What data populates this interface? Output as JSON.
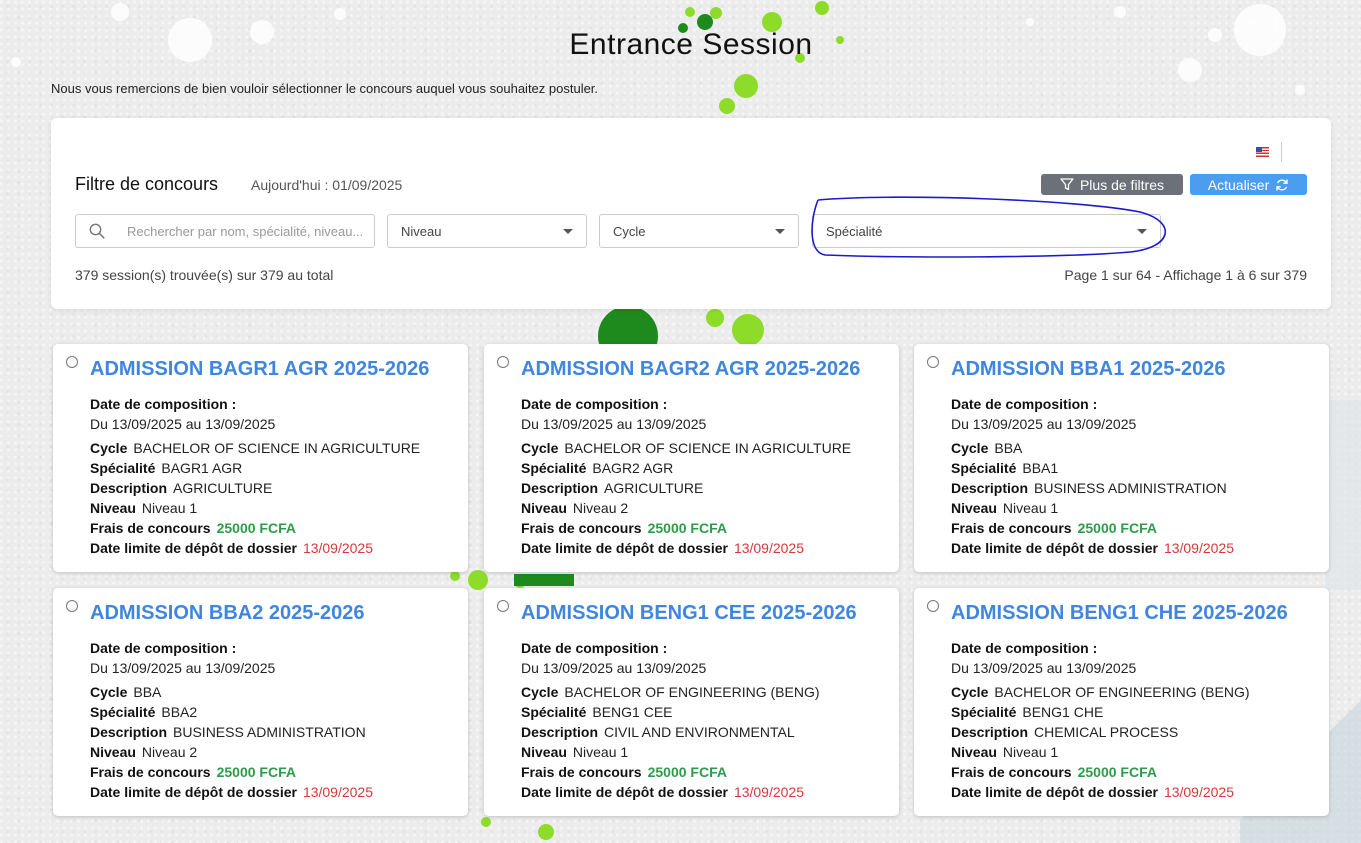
{
  "page": {
    "title": "Entrance Session",
    "intro": "Nous vous remercions de bien vouloir sélectionner le concours auquel vous souhaitez postuler."
  },
  "filter": {
    "title": "Filtre de concours",
    "today": "Aujourd'hui : 01/09/2025",
    "more_filters_label": "Plus de filtres",
    "refresh_label": "Actualiser",
    "search_placeholder": "Rechercher par nom, spécialité, niveau...",
    "niveau_label": "Niveau",
    "cycle_label": "Cycle",
    "specialite_label": "Spécialité",
    "count_text": "379 session(s) trouvée(s) sur 379 au total",
    "pagination_text": "Page 1 sur 64 - Affichage 1 à 6 sur 379",
    "language_flag": "us-flag-icon"
  },
  "labels": {
    "date_composition": "Date de composition :",
    "cycle": "Cycle",
    "specialite": "Spécialité",
    "description": "Description",
    "niveau": "Niveau",
    "frais": "Frais de concours",
    "date_limite": "Date limite de dépôt de dossier"
  },
  "colors": {
    "accent_blue": "#3f86e0",
    "fee_green": "#2e9b4a",
    "deadline_red": "#d6383c",
    "annotation_blue": "#1a1ad0"
  },
  "sessions": [
    {
      "title": "ADMISSION BAGR1 AGR 2025-2026",
      "dates": "Du 13/09/2025 au 13/09/2025",
      "cycle": "BACHELOR OF SCIENCE IN AGRICULTURE",
      "specialite": "BAGR1 AGR",
      "description": "AGRICULTURE",
      "niveau": "Niveau 1",
      "frais": "25000 FCFA",
      "date_limite": "13/09/2025"
    },
    {
      "title": "ADMISSION BAGR2 AGR 2025-2026",
      "dates": "Du 13/09/2025 au 13/09/2025",
      "cycle": "BACHELOR OF SCIENCE IN AGRICULTURE",
      "specialite": "BAGR2 AGR",
      "description": "AGRICULTURE",
      "niveau": "Niveau 2",
      "frais": "25000 FCFA",
      "date_limite": "13/09/2025"
    },
    {
      "title": "ADMISSION BBA1 2025-2026",
      "dates": "Du 13/09/2025 au 13/09/2025",
      "cycle": "BBA",
      "specialite": "BBA1",
      "description": "BUSINESS ADMINISTRATION",
      "niveau": "Niveau 1",
      "frais": "25000 FCFA",
      "date_limite": "13/09/2025"
    },
    {
      "title": "ADMISSION BBA2 2025-2026",
      "dates": "Du 13/09/2025 au 13/09/2025",
      "cycle": "BBA",
      "specialite": "BBA2",
      "description": "BUSINESS ADMINISTRATION",
      "niveau": "Niveau 2",
      "frais": "25000 FCFA",
      "date_limite": "13/09/2025"
    },
    {
      "title": "ADMISSION BENG1 CEE 2025-2026",
      "dates": "Du 13/09/2025 au 13/09/2025",
      "cycle": "BACHELOR OF ENGINEERING (BENG)",
      "specialite": "BENG1 CEE",
      "description": "CIVIL AND ENVIRONMENTAL",
      "niveau": "Niveau 1",
      "frais": "25000 FCFA",
      "date_limite": "13/09/2025"
    },
    {
      "title": "ADMISSION BENG1 CHE 2025-2026",
      "dates": "Du 13/09/2025 au 13/09/2025",
      "cycle": "BACHELOR OF ENGINEERING (BENG)",
      "specialite": "BENG1 CHE",
      "description": "CHEMICAL PROCESS",
      "niveau": "Niveau 1",
      "frais": "25000 FCFA",
      "date_limite": "13/09/2025"
    }
  ]
}
